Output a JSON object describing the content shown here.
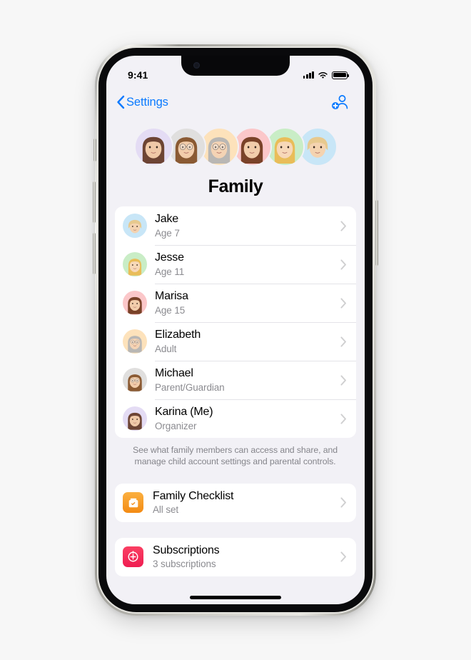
{
  "status_bar": {
    "time": "9:41",
    "signal_icon": "cellular-bars-icon",
    "wifi_icon": "wifi-icon",
    "battery_icon": "battery-full-icon"
  },
  "nav_bar": {
    "back_label": "Settings",
    "back_icon": "chevron-left-icon",
    "add_member_icon": "add-person-icon"
  },
  "header": {
    "title": "Family",
    "avatars": [
      {
        "name": "Karina",
        "bg": "#e4dcf4",
        "hair": "#6d4434",
        "skin": "#f0c9a8",
        "style": "long"
      },
      {
        "name": "Michael",
        "bg": "#e0dfde",
        "hair": "#8a5a33",
        "skin": "#f2cdab",
        "style": "glasses"
      },
      {
        "name": "Elizabeth",
        "bg": "#fde2bb",
        "hair": "#b9b7b4",
        "skin": "#f4d3b4",
        "style": "glasses"
      },
      {
        "name": "Marisa",
        "bg": "#fbc7c9",
        "hair": "#7a4228",
        "skin": "#f2cdab",
        "style": "long"
      },
      {
        "name": "Jesse",
        "bg": "#c9edc6",
        "hair": "#e9bd59",
        "skin": "#f7d8b8",
        "style": "blonde"
      },
      {
        "name": "Jake",
        "bg": "#c8e6f7",
        "hair": "#e7c98e",
        "skin": "#f4d3b0",
        "style": "short"
      }
    ]
  },
  "members": {
    "items": [
      {
        "name": "Jake",
        "detail": "Age 7",
        "bg": "#c8e6f7",
        "hair": "#e7c98e",
        "skin": "#f4d3b0",
        "style": "short"
      },
      {
        "name": "Jesse",
        "detail": "Age 11",
        "bg": "#c9edc6",
        "hair": "#e9bd59",
        "skin": "#f7d8b8",
        "style": "blonde"
      },
      {
        "name": "Marisa",
        "detail": "Age 15",
        "bg": "#fbc7c9",
        "hair": "#7a4228",
        "skin": "#f2cdab",
        "style": "long"
      },
      {
        "name": "Elizabeth",
        "detail": "Adult",
        "bg": "#fde2bb",
        "hair": "#b9b7b4",
        "skin": "#f4d3b4",
        "style": "glasses"
      },
      {
        "name": "Michael",
        "detail": "Parent/Guardian",
        "bg": "#e0dfde",
        "hair": "#8a5a33",
        "skin": "#f2cdab",
        "style": "glasses"
      },
      {
        "name": "Karina (Me)",
        "detail": "Organizer",
        "bg": "#e4dcf4",
        "hair": "#6d4434",
        "skin": "#f0c9a8",
        "style": "long"
      }
    ],
    "footnote": "See what family members can access and share, and manage child account settings and parental controls."
  },
  "checklist": {
    "title": "Family Checklist",
    "detail": "All set",
    "icon": "family-checklist-icon",
    "icon_color": "#f79522"
  },
  "subscriptions": {
    "title": "Subscriptions",
    "detail": "3 subscriptions",
    "icon": "subscriptions-icon",
    "icon_color": "#f5315c"
  },
  "colors": {
    "accent": "#0a7aff",
    "page_bg": "#f2f1f6",
    "card_bg": "#ffffff",
    "secondary_text": "#8b8b90"
  }
}
